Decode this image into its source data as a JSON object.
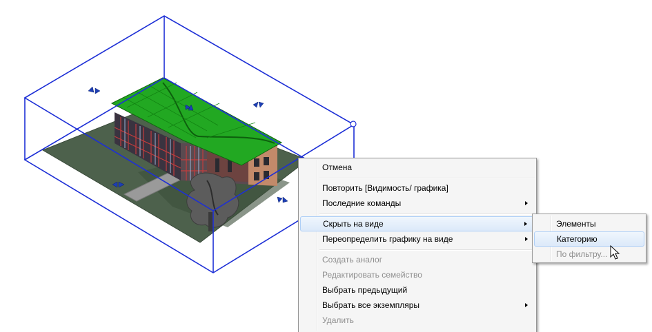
{
  "context_menu": {
    "items": [
      {
        "label": "Отмена"
      },
      {
        "label": "Повторить [Видимость/ графика]"
      },
      {
        "label": "Последние команды"
      },
      {
        "label": "Скрыть на виде"
      },
      {
        "label": "Переопределить графику на виде"
      },
      {
        "label": "Создать аналог"
      },
      {
        "label": "Редактировать семейство"
      },
      {
        "label": "Выбрать предыдущий"
      },
      {
        "label": "Выбрать все экземпляры"
      },
      {
        "label": "Удалить"
      }
    ]
  },
  "submenu": {
    "items": [
      {
        "label": "Элементы"
      },
      {
        "label": "Категорию"
      },
      {
        "label": "По фильтру..."
      }
    ]
  },
  "colors": {
    "section_box": "#1d2fd6",
    "roof": "#1fa31f",
    "ground": "#4a5f4a",
    "menu_highlight": "#dce9f9"
  }
}
